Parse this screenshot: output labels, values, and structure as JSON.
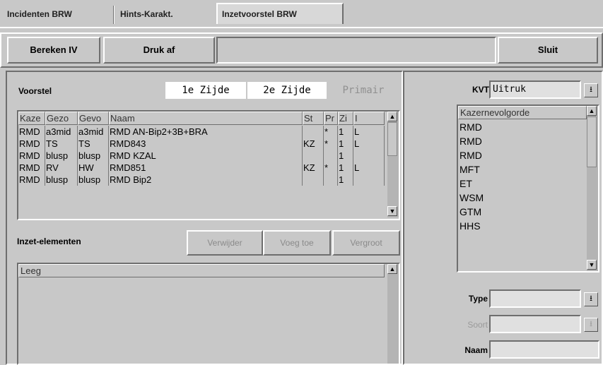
{
  "tabs": [
    {
      "label": "Incidenten BRW"
    },
    {
      "label": "Hints-Karakt."
    },
    {
      "label": "Inzetvoorstel BRW"
    }
  ],
  "toolbar": {
    "bereken_label": "Bereken IV",
    "druk_label": "Druk af",
    "sluit_label": "Sluit"
  },
  "voorstel": {
    "title": "Voorstel",
    "option1": "1e Zijde",
    "option2": "2e Zijde",
    "option3": "Primair",
    "columns": [
      "Kaze",
      "Gezo",
      "Gevo",
      "Naam",
      "St",
      "Pr",
      "Zi",
      "I"
    ],
    "rows": [
      [
        "RMD",
        "a3mid",
        "a3mid",
        "RMD AN-Bip2+3B+BRA",
        "",
        "*",
        "1",
        "L"
      ],
      [
        "RMD",
        "TS",
        "TS",
        "RMD843",
        "KZ",
        "*",
        "1",
        "L"
      ],
      [
        "RMD",
        "blusp",
        "blusp",
        "RMD KZAL",
        "",
        "",
        "1",
        ""
      ],
      [
        "RMD",
        "RV",
        "HW",
        "RMD851",
        "KZ",
        "*",
        "1",
        "L"
      ],
      [
        "RMD",
        "blusp",
        "blusp",
        "RMD Bip2",
        "",
        "",
        "1",
        ""
      ]
    ]
  },
  "inzet": {
    "title": "Inzet-elementen",
    "verwijder_label": "Verwijder",
    "voeg_toe_label": "Voeg toe",
    "vergroot_label": "Vergroot",
    "column": "Leeg"
  },
  "right": {
    "kvt_label": "KVT",
    "kvt_value": "Uitruk",
    "list_header": "Kazernevolgorde",
    "list_items": [
      "RMD",
      "RMD",
      "RMD",
      "MFT",
      "ET",
      "WSM",
      "GTM",
      "HHS"
    ],
    "type_label": "Type",
    "soort_label": "Soort",
    "naam_label": "Naam"
  }
}
